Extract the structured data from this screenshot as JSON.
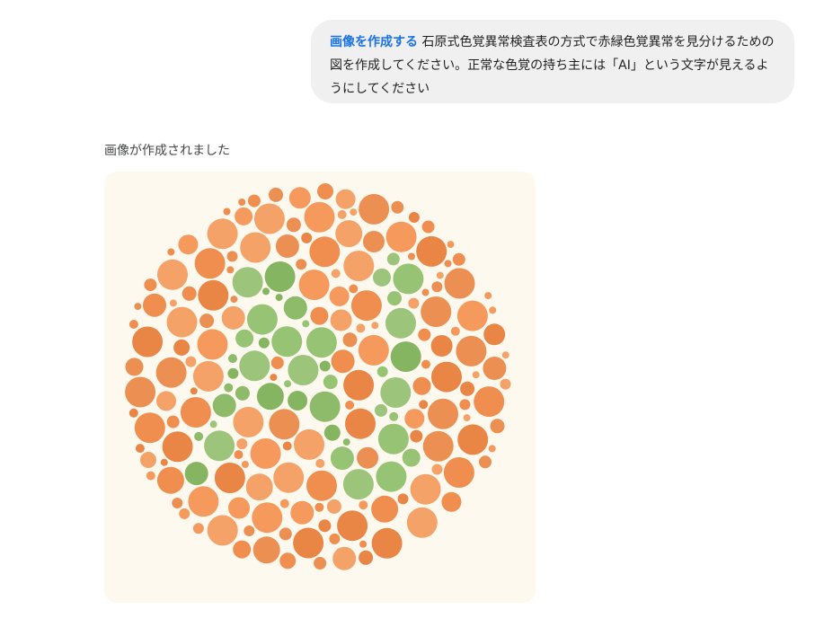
{
  "user_message": {
    "tool_label": "画像を作成する",
    "text": "石原式色覚異常検査表の方式で赤緑色覚異常を見分けるための図を作成してください。正常な色覚の持ち主には「AI」という文字が見えるようにしてください"
  },
  "response": {
    "label": "画像が作成されました"
  },
  "generated_image": {
    "hidden_text": "AI",
    "background_color": "#fdf9ef",
    "dot_colors": {
      "orange": [
        "#ef8e4f",
        "#f4a268",
        "#e98545",
        "#f59a5c",
        "#ec8f52"
      ],
      "green": [
        "#8dbb6a",
        "#97c374",
        "#86b561",
        "#9cc47b"
      ]
    }
  }
}
